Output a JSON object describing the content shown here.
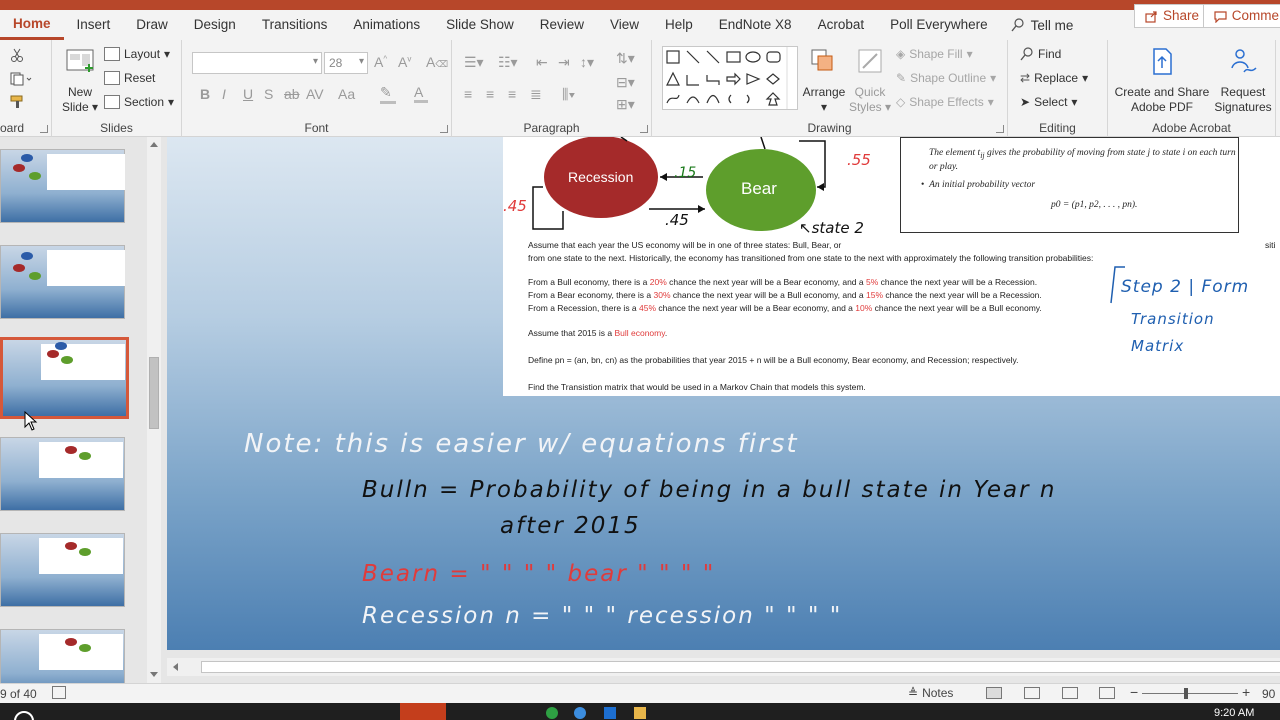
{
  "ribbon_tabs": [
    "Home",
    "Insert",
    "Draw",
    "Design",
    "Transitions",
    "Animations",
    "Slide Show",
    "Review",
    "View",
    "Help",
    "EndNote X8",
    "Acrobat",
    "Poll Everywhere"
  ],
  "tell_me": "Tell me",
  "share_label": "Share",
  "comments_label": "Comme",
  "clipboard_label": "oard",
  "slides_group": {
    "label": "Slides",
    "new_slide": "New",
    "new_slide_line2": "Slide",
    "layout": "Layout",
    "reset": "Reset",
    "section": "Section"
  },
  "font_group": {
    "label": "Font",
    "font_name": "",
    "font_size": "28"
  },
  "paragraph_group": {
    "label": "Paragraph"
  },
  "drawing_group": {
    "label": "Drawing",
    "arrange": "Arrange",
    "quick_styles_1": "Quick",
    "quick_styles_2": "Styles",
    "shape_fill": "Shape Fill",
    "shape_outline": "Shape Outline",
    "shape_effects": "Shape Effects"
  },
  "editing_group": {
    "label": "Editing",
    "find": "Find",
    "replace": "Replace",
    "select": "Select"
  },
  "acrobat_group": {
    "label": "Adobe Acrobat",
    "create_share_1": "Create and Share",
    "create_share_2": "Adobe PDF",
    "request_sig_1": "Request",
    "request_sig_2": "Signatures"
  },
  "slide": {
    "node_recession": "Recession",
    "node_bear": "Bear",
    "prob_15": ".15",
    "prob_55": ".55",
    "prob_45a": ".45",
    "prob_45b": ".45",
    "state_label": "state 2",
    "def_line1": "The element t",
    "def_line1_sub": "ij",
    "def_line1_rest": " gives the probability of moving from state j to state i on each turn",
    "def_line2": "or play.",
    "def_bullet": "An initial probability vector",
    "def_formula": "p0 = (p1, p2, . . . , pn).",
    "para1_a": "Assume that each year the US economy will be in one of three states: Bull, Bear, or",
    "para1_tail": "siti",
    "para1_b": "from one state to the next. Historically, the economy has transitioned from one state to the next with approximately the following transition probabilities:",
    "bull_1": "From a Bull economy, there is a ",
    "bull_pct1": "20%",
    "bull_2": " chance the next year will be a Bear economy, and a ",
    "bull_pct2": "5%",
    "bull_3": " chance the next year will be a Recession.",
    "bear_1": "From a Bear economy, there is a ",
    "bear_pct1": "30%",
    "bear_2": " chance the next year will be a Bull economy, and a ",
    "bear_pct2": "15%",
    "bear_3": " chance the next year will be a Recession.",
    "rec_1": "From a Recession, there is a ",
    "rec_pct1": "45%",
    "rec_2": " chance the next year will be a Bear economy, and a ",
    "rec_pct2": "10%",
    "rec_3": " chance the next year will be a Bull economy.",
    "assume_1": "Assume that 2015 is a ",
    "assume_red": "Bull economy",
    "assume_2": ".",
    "define_line": "Define pn = (an, bn, cn)  as the probabilities that year  2015 + n  will be a Bull economy, Bear economy, and Recession; respectively.",
    "find_line": "Find the Transistion matrix that would be used in a Markov Chain that models this system.",
    "step_1": "Step 2 | Form",
    "step_2": "Transition",
    "step_3": "Matrix",
    "note": "Note: this is easier w/ equations first",
    "bull_eq": "Bulln =  Probability of being in a bull state  in Year n",
    "bull_eq2": "after  2015",
    "bear_eq": "Bearn  =   \"        \"      \"   \"  bear \"   \"   \" \"",
    "rec_eq": "Recession n  =   \"          \"        \" recession \" \" \" \""
  },
  "status": {
    "slide_count": "9 of 40",
    "notes": "Notes",
    "zoom": "90"
  },
  "taskbar": {
    "time": "9:20 AM"
  },
  "colors": {
    "accent": "#b7472a",
    "recession_node": "#a52a2a",
    "bear_node": "#5e9e2c",
    "annotation_red": "#e03b3b",
    "ink_blue": "#1f5fb0"
  }
}
